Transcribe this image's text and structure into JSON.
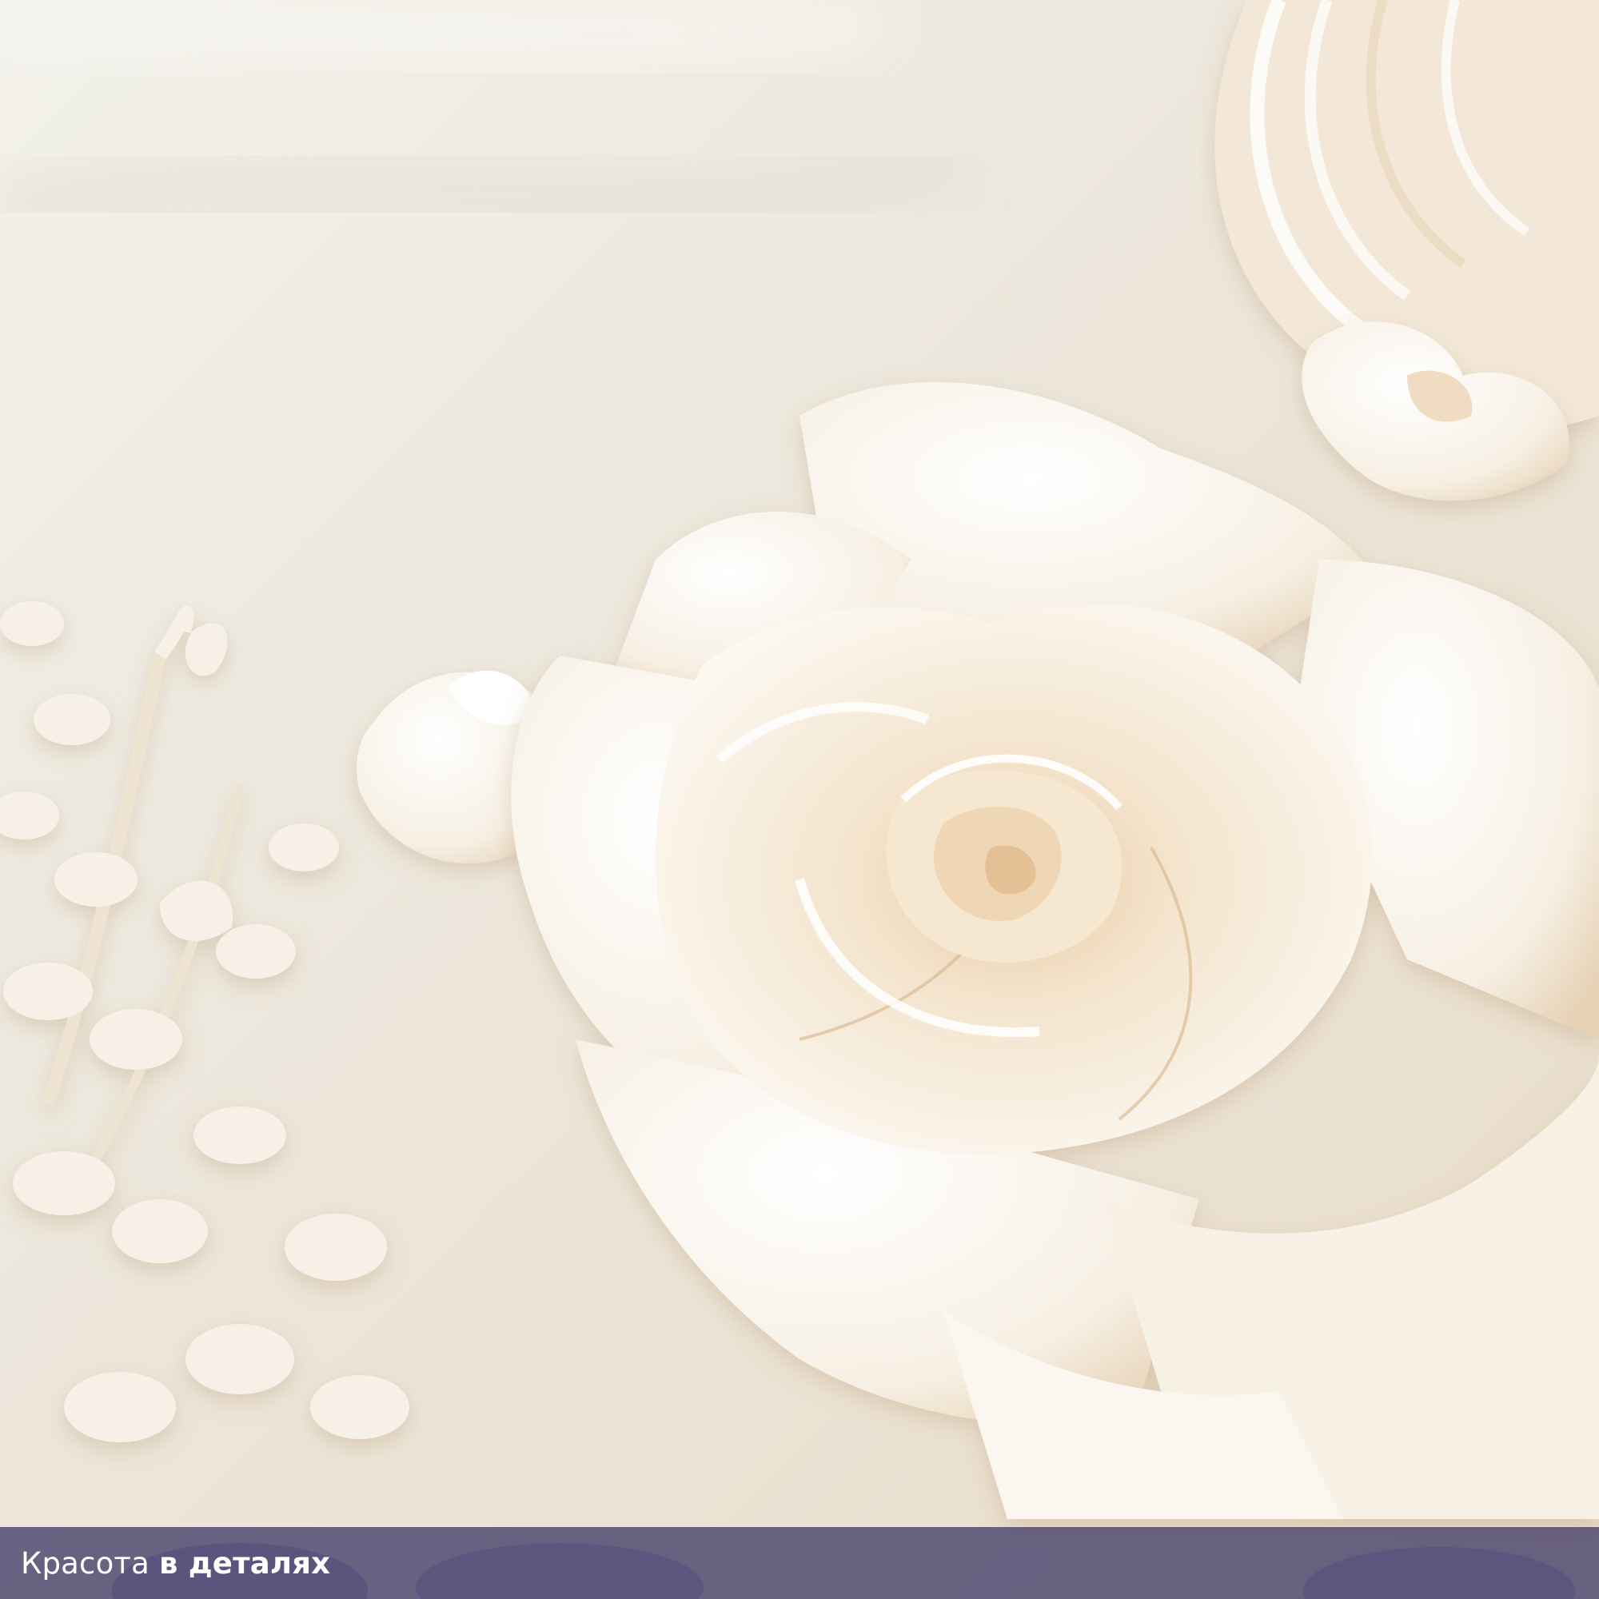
{
  "caption": {
    "regular": "Красота",
    "bold": "в деталях"
  },
  "colors": {
    "background": "#efe9df",
    "petal": "#fbf8f2",
    "petal_shadow": "#e7cfae",
    "rose_center": "#e6c39a",
    "caption_bar": "#4b446e",
    "caption_text": "#ffffff"
  }
}
